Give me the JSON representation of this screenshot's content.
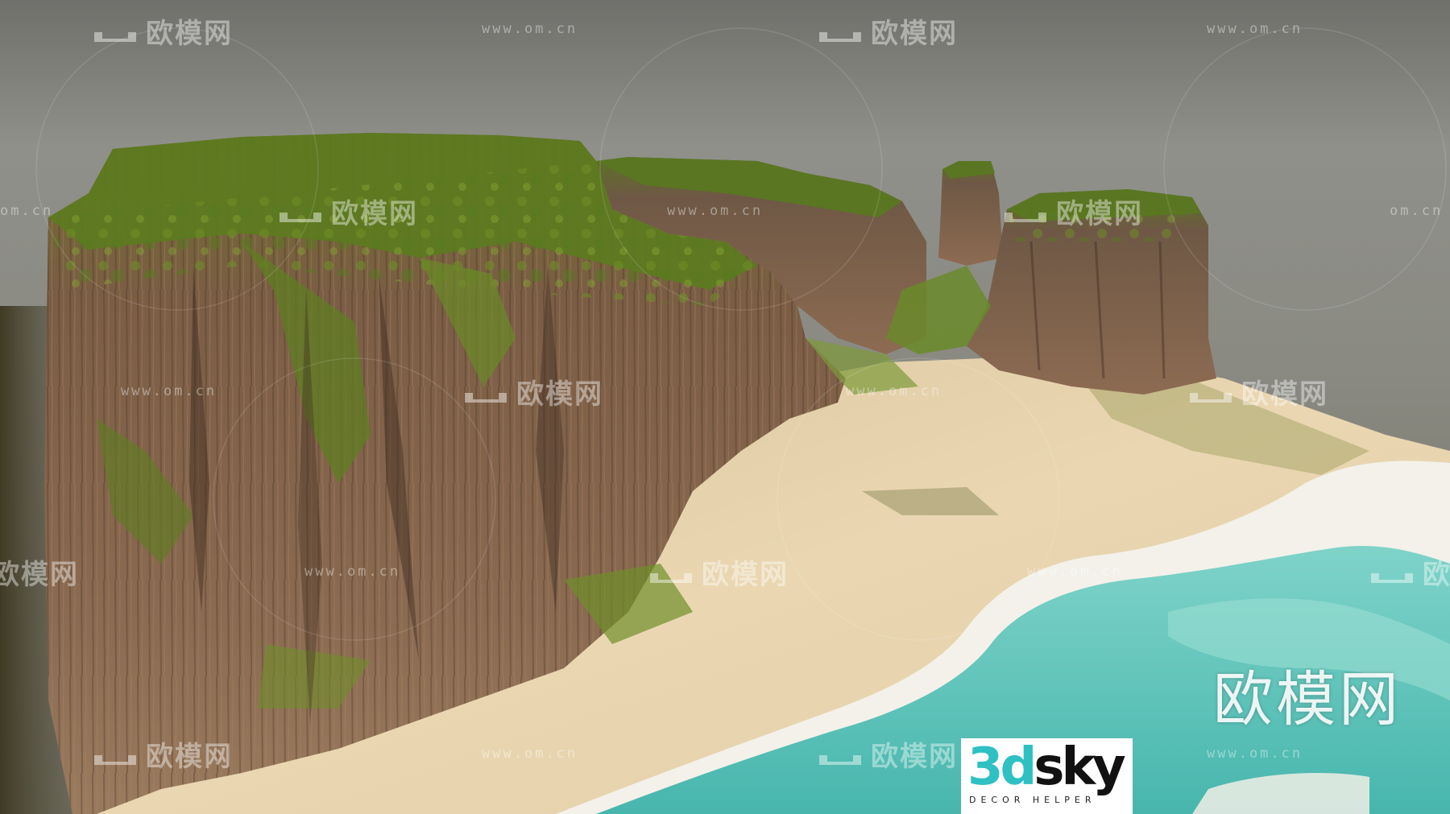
{
  "watermark": {
    "brand": "欧模网",
    "url": "www.om.cn",
    "url_partial": "om.cn"
  },
  "corner_mark": "欧模网",
  "logo": {
    "main_colored": "3d",
    "main_dark": "sky",
    "subtitle": "DECOR HELPER",
    "accent_color": "#2fc0c4"
  },
  "colors": {
    "sky": "#8d8d86",
    "rock": "#7a5a43",
    "moss": "#5f7a22",
    "sand": "#e6d2ac",
    "water": "#5fc4bb"
  }
}
